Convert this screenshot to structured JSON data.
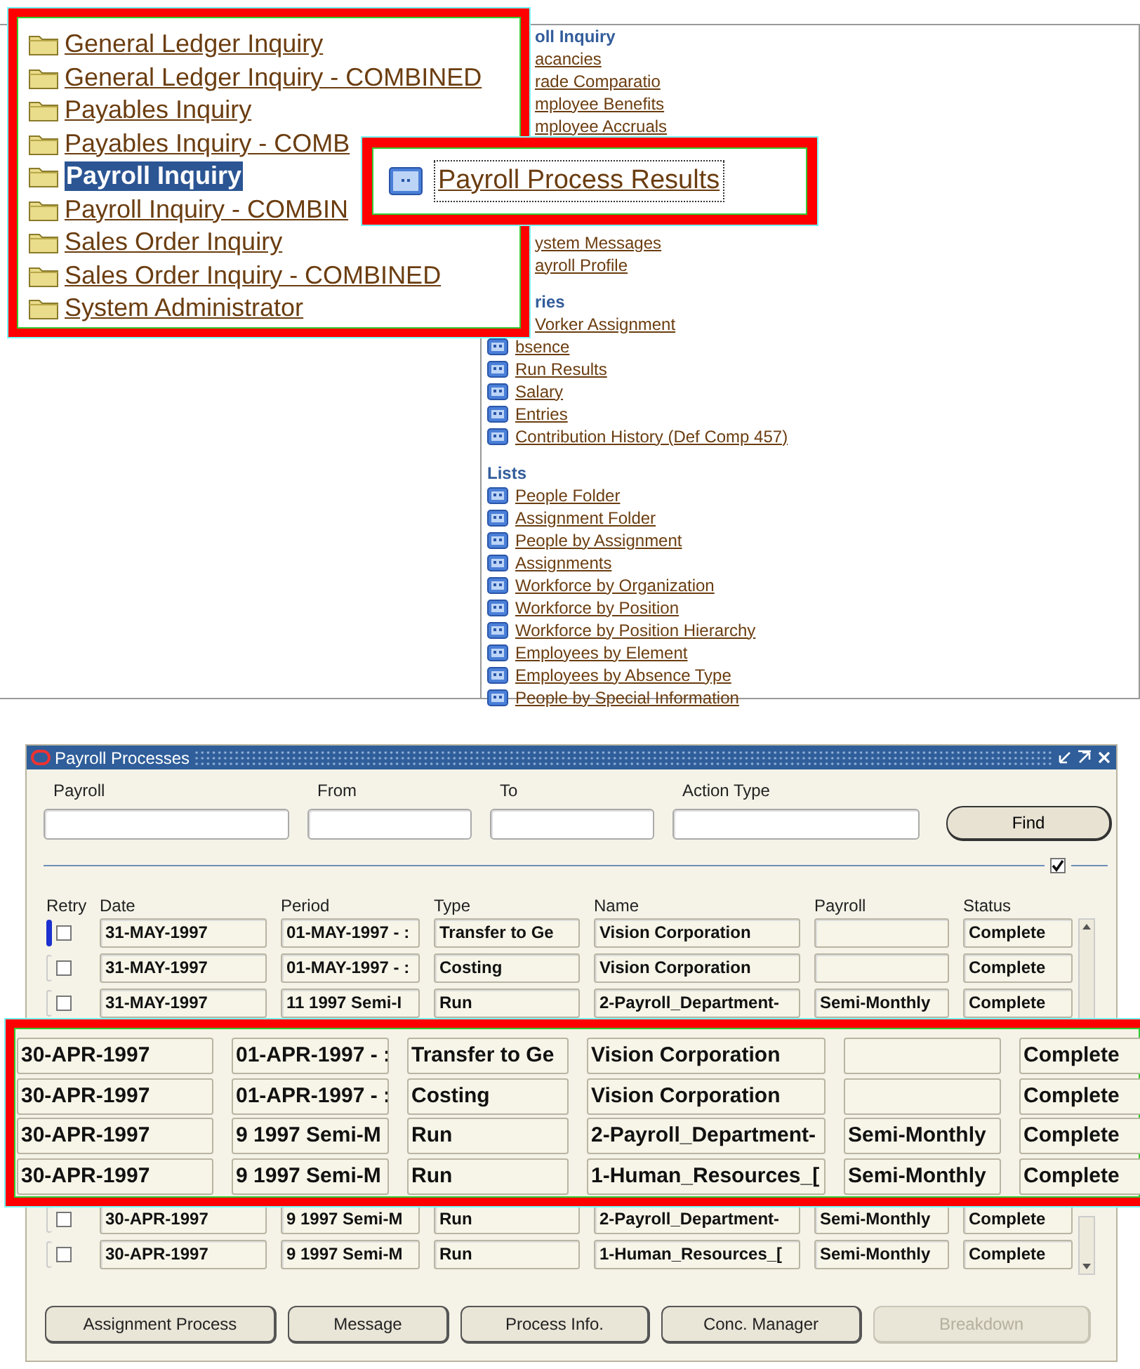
{
  "menu_callout": {
    "items": [
      {
        "label": "General Ledger Inquiry",
        "selected": false
      },
      {
        "label": "General Ledger Inquiry - COMBINED",
        "selected": false
      },
      {
        "label": "Payables Inquiry",
        "selected": false
      },
      {
        "label": "Payables Inquiry - COMB",
        "selected": false
      },
      {
        "label": "Payroll Inquiry",
        "selected": true
      },
      {
        "label": "Payroll Inquiry - COMBIN",
        "selected": false
      },
      {
        "label": "Sales Order Inquiry",
        "selected": false
      },
      {
        "label": "Sales Order Inquiry - COMBINED",
        "selected": false
      },
      {
        "label": "System Administrator",
        "selected": false
      }
    ]
  },
  "process_callout": {
    "label": "Payroll Process Results"
  },
  "links_panel": {
    "groups": [
      {
        "heading": "oll Inquiry",
        "links": [
          {
            "label": "acancies",
            "icon": false
          },
          {
            "label": "rade Comparatio",
            "icon": false
          },
          {
            "label": "mployee Benefits",
            "icon": false
          },
          {
            "label": "mployee Accruals",
            "icon": false
          }
        ]
      },
      {
        "links": [
          {
            "label": "ystem Messages",
            "icon": false
          },
          {
            "label": "ayroll Profile",
            "icon": false
          }
        ]
      },
      {
        "heading": "ries",
        "links": [
          {
            "label": "Vorker Assignment",
            "icon": false
          },
          {
            "label": "bsence",
            "icon": true
          },
          {
            "label": "Run Results",
            "icon": true
          },
          {
            "label": "Salary",
            "icon": true
          },
          {
            "label": "Entries",
            "icon": true
          },
          {
            "label": "Contribution History (Def Comp 457)",
            "icon": true
          }
        ]
      },
      {
        "heading": "Lists",
        "links": [
          {
            "label": "People Folder",
            "icon": true
          },
          {
            "label": "Assignment Folder",
            "icon": true
          },
          {
            "label": "People by Assignment",
            "icon": true
          },
          {
            "label": "Assignments",
            "icon": true
          },
          {
            "label": "Workforce by Organization",
            "icon": true
          },
          {
            "label": "Workforce by Position",
            "icon": true
          },
          {
            "label": "Workforce by Position Hierarchy",
            "icon": true
          },
          {
            "label": "Employees by Element",
            "icon": true
          },
          {
            "label": "Employees by Absence Type",
            "icon": true
          },
          {
            "label": "People by Special Information",
            "icon": true
          }
        ]
      }
    ]
  },
  "payroll_processes": {
    "title": "Payroll Processes",
    "fields": [
      {
        "label": "Payroll"
      },
      {
        "label": "From"
      },
      {
        "label": "To"
      },
      {
        "label": "Action Type"
      }
    ],
    "find_button": "Find",
    "show_details_checked": true,
    "columns": [
      "Retry",
      "Date",
      "Period",
      "Type",
      "Name",
      "Payroll",
      "Status"
    ],
    "row_groups": [
      [
        {
          "current": true,
          "retry_checked": false,
          "date": "31-MAY-1997",
          "period": "01-MAY-1997 - :",
          "type": "Transfer to Ge",
          "name": "Vision Corporation",
          "status": "Complete"
        },
        {
          "current": false,
          "retry_checked": false,
          "date": "31-MAY-1997",
          "period": "01-MAY-1997 - :",
          "type": "Costing",
          "name": "Vision Corporation",
          "status": "Complete"
        },
        {
          "current": false,
          "retry_checked": false,
          "date": "31-MAY-1997",
          "period": "11 1997 Semi-I",
          "type": "Run",
          "name": "2-Payroll_Department-",
          "payroll": "Semi-Monthly",
          "status": "Complete"
        }
      ],
      [
        {
          "current": false,
          "retry_checked": false,
          "date": "30-APR-1997",
          "period": "9 1997 Semi-M",
          "type": "Run",
          "name": "2-Payroll_Department-",
          "payroll": "Semi-Monthly",
          "status": "Complete"
        },
        {
          "current": false,
          "retry_checked": false,
          "date": "30-APR-1997",
          "period": "9 1997 Semi-M",
          "type": "Run",
          "name": "1-Human_Resources_[",
          "payroll": "Semi-Monthly",
          "status": "Complete"
        }
      ]
    ],
    "buttons": [
      {
        "label": "Assignment Process",
        "disabled": false
      },
      {
        "label": "Message",
        "disabled": false
      },
      {
        "label": "Process Info.",
        "disabled": false
      },
      {
        "label": "Conc. Manager",
        "disabled": false
      },
      {
        "label": "Breakdown",
        "disabled": true
      }
    ]
  },
  "rows_callout": {
    "rows": [
      {
        "date": "30-APR-1997",
        "period": "01-APR-1997 - :",
        "type": "Transfer to Ge",
        "name": "Vision Corporation",
        "status": "Complete"
      },
      {
        "date": "30-APR-1997",
        "period": "01-APR-1997 - :",
        "type": "Costing",
        "name": "Vision Corporation",
        "status": "Complete"
      },
      {
        "date": "30-APR-1997",
        "period": "9 1997 Semi-M",
        "type": "Run",
        "name": "2-Payroll_Department-",
        "payroll": "Semi-Monthly",
        "status": "Complete"
      },
      {
        "date": "30-APR-1997",
        "period": "9 1997 Semi-M",
        "type": "Run",
        "name": "1-Human_Resources_[",
        "payroll": "Semi-Monthly",
        "status": "Complete"
      }
    ]
  }
}
